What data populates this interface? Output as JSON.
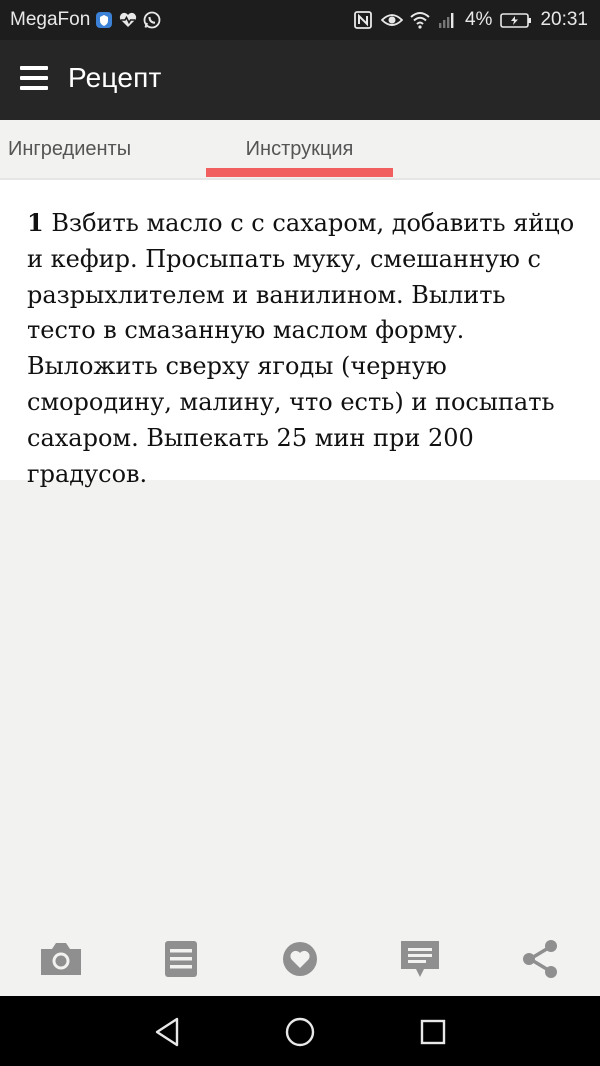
{
  "status_bar": {
    "carrier": "MegaFon",
    "battery_percent": "4%",
    "time": "20:31",
    "icons": [
      "shield-icon",
      "heart-pulse-icon",
      "whatsapp-icon",
      "nfc-icon",
      "eye-icon",
      "wifi-icon",
      "signal-icon",
      "battery-icon"
    ]
  },
  "toolbar": {
    "title": "Рецепт",
    "menu_icon": "hamburger-menu-icon"
  },
  "tabs": [
    {
      "label": "Ингредиенты",
      "active": false
    },
    {
      "label": "Инструкция",
      "active": true
    }
  ],
  "accent_color": "#f25f5f",
  "instructions": [
    {
      "number": "1",
      "text": "Взбить масло с с сахаром, добавить яйцо и кефир. Просыпать муку, смешанную с разрыхлителем и ванилином. Вылить тесто в смазанную маслом форму. Выложить сверху ягоды (черную смородину, малину, что есть) и посыпать сахаром. Выпекать 25 мин при 200 градусов."
    }
  ],
  "bottom_actions": [
    "camera-icon",
    "notes-icon",
    "heart-icon",
    "comment-icon",
    "share-icon"
  ],
  "nav_bar": [
    "back-icon",
    "home-icon",
    "recents-icon"
  ]
}
